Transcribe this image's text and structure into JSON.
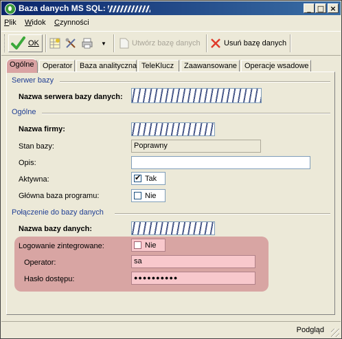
{
  "window": {
    "title": "Baza danych MS SQL:",
    "title_redacted_suffix": ""
  },
  "menubar": {
    "items": [
      {
        "label": "Plik",
        "key": "P",
        "rest": "lik"
      },
      {
        "label": "Widok",
        "key": "W",
        "rest": "idok"
      },
      {
        "label": "Czynności",
        "key": "C",
        "rest": "zynności"
      }
    ]
  },
  "toolbar": {
    "ok_label": "OK",
    "create_label": "Utwórz bazę danych",
    "delete_label": "Usuń bazę danych"
  },
  "tabs": [
    "Ogólne",
    "Operator",
    "Baza analityczna",
    "TeleKlucz",
    "Zaawansowane",
    "Operacje wsadowe"
  ],
  "active_tab": "Ogólne",
  "form": {
    "section_server": "Serwer bazy",
    "server_name_label": "Nazwa serwera bazy danych:",
    "section_general": "Ogólne",
    "company_name_label": "Nazwa firmy:",
    "db_state_label": "Stan bazy:",
    "db_state_value": "Poprawny",
    "description_label": "Opis:",
    "description_value": "",
    "active_label": "Aktywna:",
    "active_value": "Tak",
    "active_checked": true,
    "main_db_label": "Główna baza programu:",
    "main_db_value": "Nie",
    "main_db_checked": false,
    "section_connection": "Połączenie do bazy danych",
    "db_name_label": "Nazwa bazy danych:",
    "integrated_login_label": "Logowanie zintegrowane:",
    "integrated_login_value": "Nie",
    "integrated_login_checked": false,
    "operator_label": "Operator:",
    "operator_value": "sa",
    "password_label": "Hasło dostępu:",
    "password_value": "●●●●●●●●●●"
  },
  "statusbar": {
    "text": "Podgląd"
  },
  "colors": {
    "title_start": "#0a246a",
    "title_end": "#3a6ea5",
    "section_text": "#1f3e94",
    "highlight": "#c86e78"
  }
}
